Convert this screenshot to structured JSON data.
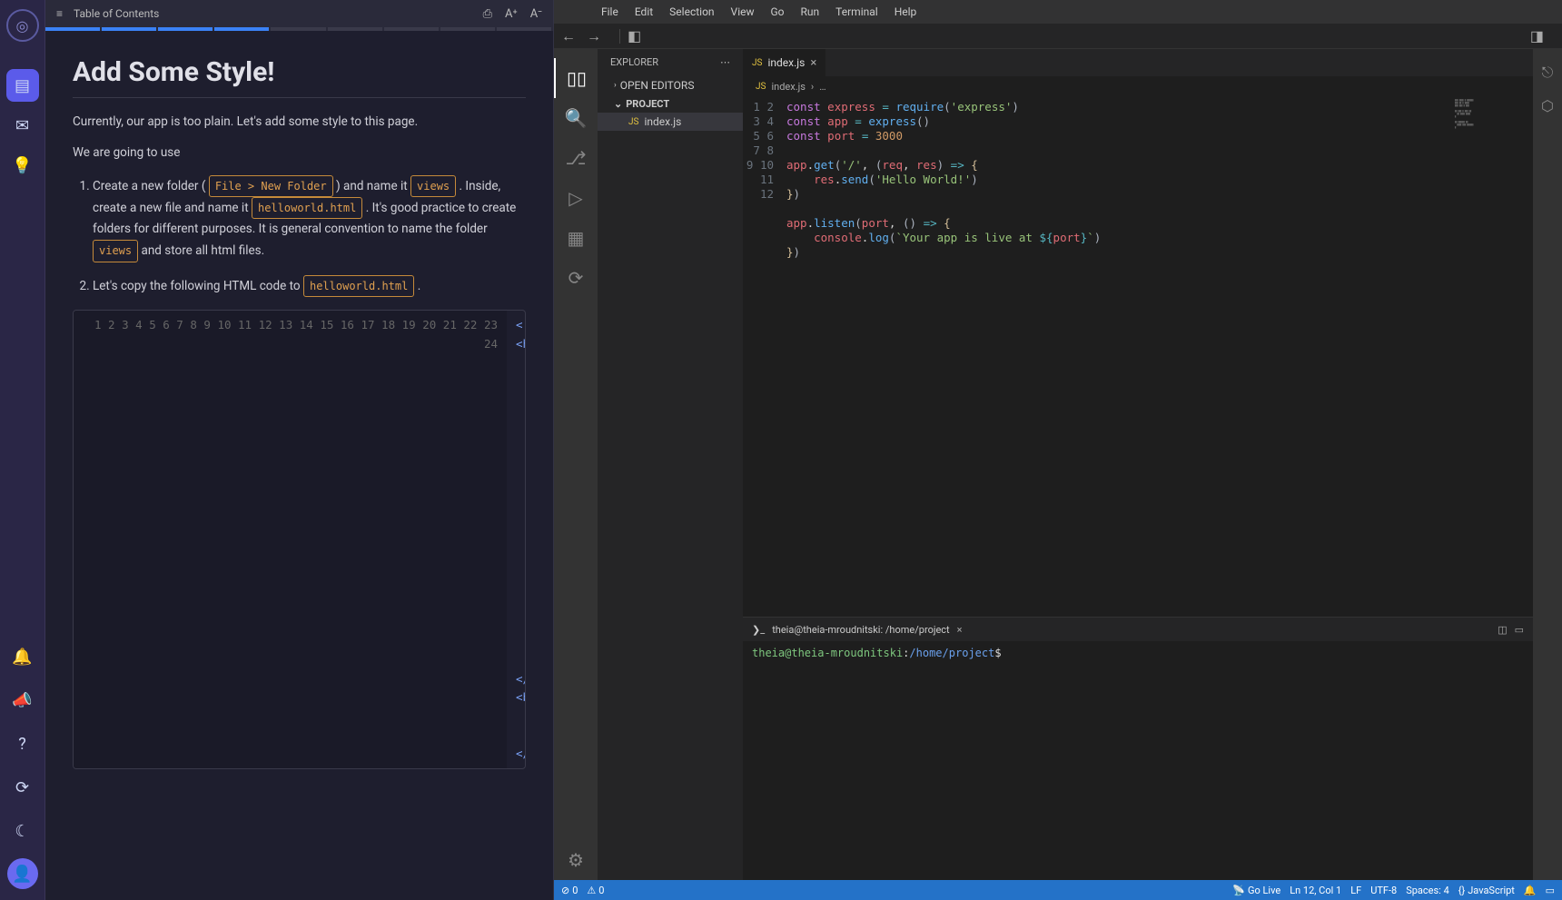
{
  "rail": {
    "logo": "◎"
  },
  "lesson": {
    "toc_label": "Table of Contents",
    "title": "Add Some Style!",
    "intro1": "Currently, our app is too plain. Let's add some style to this page.",
    "intro2": "We are going to use",
    "step1_a": "Create a new folder (",
    "step1_kbd1": "File > New Folder",
    "step1_b": ") and name it",
    "step1_kbd2": "views",
    "step1_c": ". Inside, create a new file and name it",
    "step1_kbd3": "helloworld.html",
    "step1_d": ". It's good practice to create folders for different purposes. It is general convention to name the folder",
    "step1_kbd4": "views",
    "step1_e": " and store all html files.",
    "step2_a": "Let's copy the following HTML code to",
    "step2_kbd1": "helloworld.html",
    "step2_b": ".",
    "code_lines": 24
  },
  "ide": {
    "menu": [
      "File",
      "Edit",
      "Selection",
      "View",
      "Go",
      "Run",
      "Terminal",
      "Help"
    ],
    "explorer_title": "EXPLORER",
    "open_editors": "OPEN EDITORS",
    "project": "PROJECT",
    "file": "index.js",
    "tab": "index.js",
    "breadcrumb_file": "index.js",
    "breadcrumb_more": "…",
    "terminal_title": "theia@theia-mroudnitski: /home/project",
    "term_user": "theia@theia-mroudnitski",
    "term_colon": ":",
    "term_path_home": "/home/",
    "term_path_proj": "project",
    "term_dollar": "$",
    "status": {
      "errors": "0",
      "warnings": "0",
      "golive": "Go Live",
      "ln": "Ln 12, Col 1",
      "eol": "LF",
      "enc": "UTF-8",
      "spaces": "Spaces: 4",
      "lang": "JavaScript"
    }
  }
}
